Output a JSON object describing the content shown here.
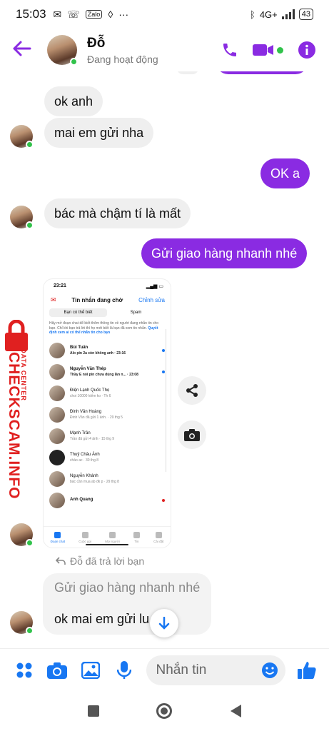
{
  "status_bar": {
    "time": "15:03",
    "network": "4G+",
    "battery": "43"
  },
  "header": {
    "name": "Đỗ",
    "status": "Đang hoạt động"
  },
  "messages": {
    "m1": "ok anh",
    "m2": "mai em gửi nha",
    "m3": "OK a",
    "m4": "bác mà chậm tí là mất",
    "m5": "Gửi giao hàng nhanh nhé"
  },
  "screenshot": {
    "time": "23:21",
    "title": "Tin nhắn đang chờ",
    "edit": "Chỉnh sửa",
    "seg_known": "Bạn có thể biết",
    "seg_spam": "Spam",
    "info": "Hãy mở đoạn chat để biết thêm thông tin về người đang nhắn tin cho bạn. Chỉ khi bạn trả lời thì họ mới biết là bạn đã xem tin nhắn.",
    "info_link": "Quyết định xem ai có thể nhắn tin cho bạn",
    "rows": [
      {
        "name": "Bùi Tuấn",
        "msg": "Alo pin 2a còn không anh · 23:16",
        "unread": true
      },
      {
        "name": "Nguyễn Văn Thép",
        "msg": "Thầy E nói pin chưa dùng lần n... · 23:08",
        "unread": true
      },
      {
        "name": "Điện Lạnh Quốc Thọ",
        "msg": "choi 10000 kiếm ko · Th 6",
        "unread": false
      },
      {
        "name": "Đinh Văn Hoàng",
        "msg": "Đinh Văn đã gửi 1 ảnh. · 29 thg 5",
        "unread": false
      },
      {
        "name": "Mạnh Trần",
        "msg": "Trần đã gửi 4 ảnh · 15 thg 9",
        "unread": false
      },
      {
        "name": "Thuỷ Châu Ánh",
        "msg": "chào ac · 30 thg 8",
        "unread": false
      },
      {
        "name": "Nguyễn Khánh",
        "msg": "bác cần mua ab đk p · 29 thg 8",
        "unread": false
      },
      {
        "name": "Anh Quang",
        "msg": "",
        "unread": true
      }
    ],
    "tabs": [
      "Đoạn chat",
      "Cuộc gọi",
      "Mọi người",
      "Tin",
      "Cài đặt"
    ]
  },
  "reply": {
    "label": "Đỗ đã trả lời bạn",
    "quoted": "Gửi giao hàng nhanh nhé",
    "answer": "ok mai em gửi lu"
  },
  "watermark": {
    "big": "CHECKSCAM.INFO",
    "small": "DATA CENTER"
  },
  "composer": {
    "placeholder": "Nhắn tin"
  },
  "colors": {
    "accent": "#8a2be2",
    "blue": "#1877f2",
    "online": "#31c24b",
    "watermark": "#e02020"
  }
}
